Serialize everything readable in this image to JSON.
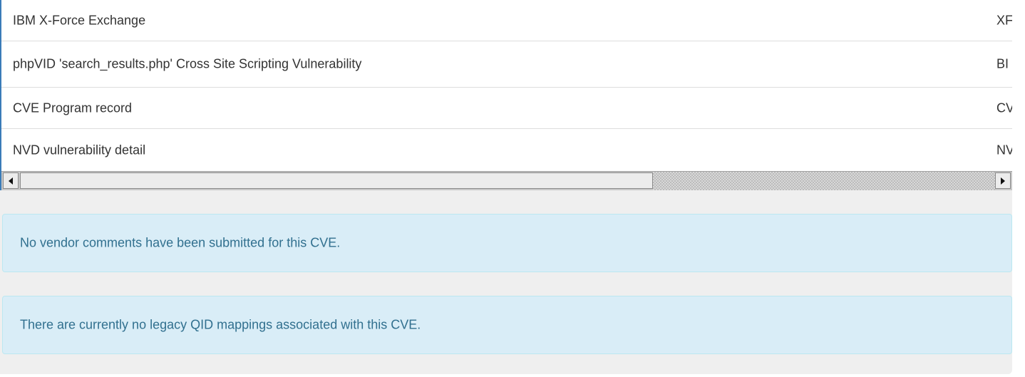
{
  "references_table": {
    "rows": [
      {
        "name": "IBM X-Force Exchange",
        "source": "XF"
      },
      {
        "name": "phpVID 'search_results.php' Cross Site Scripting Vulnerability",
        "source": "BI"
      },
      {
        "name": "CVE Program record",
        "source": "CV"
      },
      {
        "name": "NVD vulnerability detail",
        "source": "NV"
      }
    ],
    "scrollbar": {
      "position": 0,
      "visible_fraction": 0.63
    }
  },
  "vendor_comments": {
    "message": "No vendor comments have been submitted for this CVE."
  },
  "qid_mappings": {
    "message": "There are currently no legacy QID mappings associated with this CVE."
  },
  "colors": {
    "notice_background": "#d9edf7",
    "notice_text": "#31708f",
    "table_accent_border": "#3a7bb8"
  }
}
